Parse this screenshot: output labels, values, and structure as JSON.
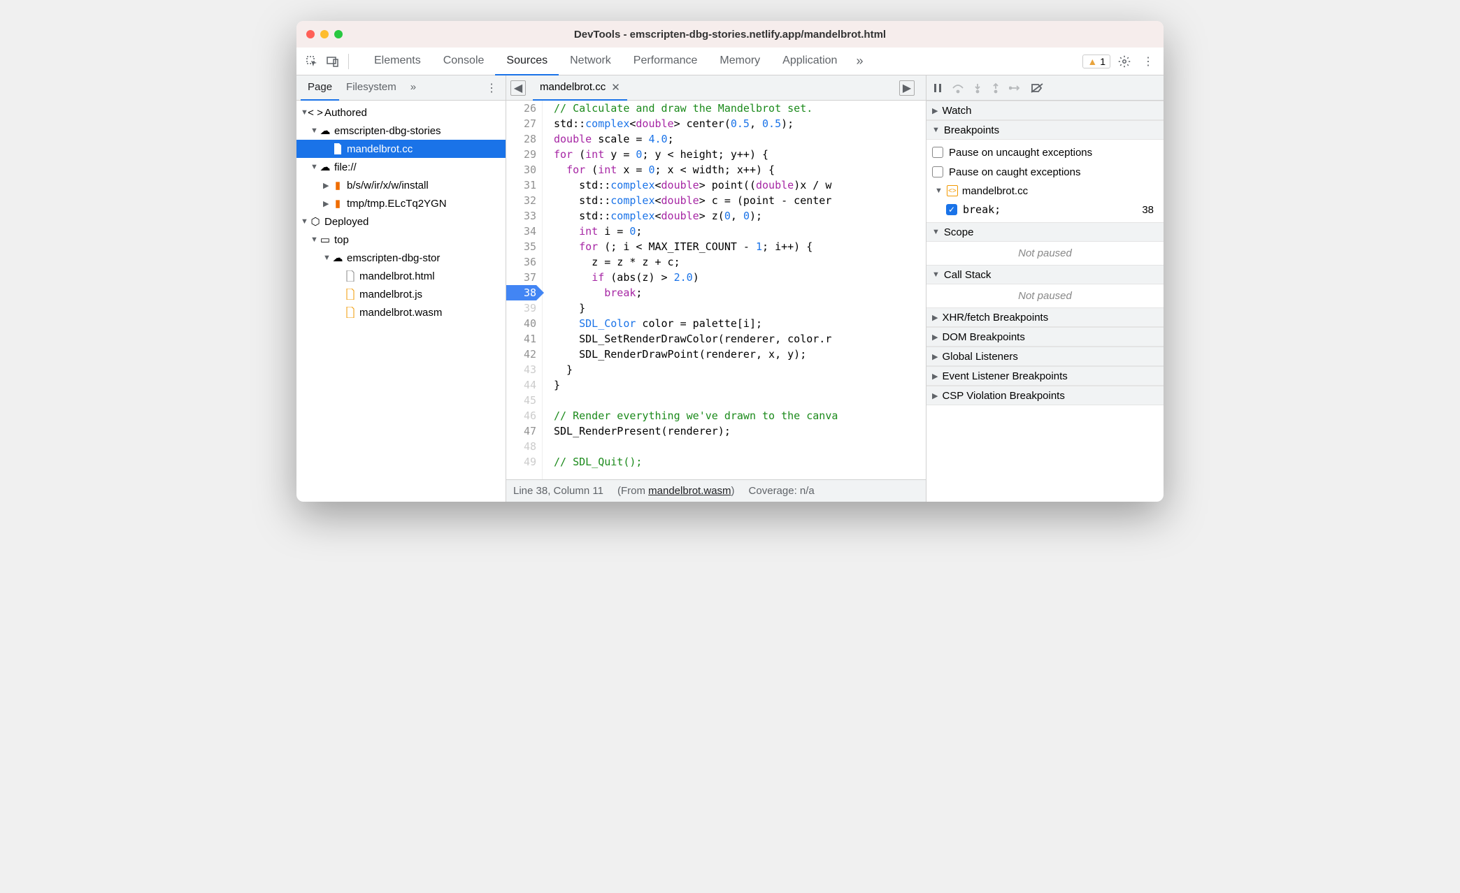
{
  "window": {
    "title": "DevTools - emscripten-dbg-stories.netlify.app/mandelbrot.html"
  },
  "toolbar": {
    "tabs": [
      "Elements",
      "Console",
      "Sources",
      "Network",
      "Performance",
      "Memory",
      "Application"
    ],
    "active_tab": "Sources",
    "warnings": "1"
  },
  "sidebar": {
    "tabs": [
      "Page",
      "Filesystem"
    ],
    "active": "Page",
    "tree": {
      "authored": "Authored",
      "site1": "emscripten-dbg-stories",
      "selected_file": "mandelbrot.cc",
      "file_proto": "file://",
      "install_path": "b/s/w/ir/x/w/install",
      "tmp_path": "tmp/tmp.ELcTq2YGN",
      "deployed": "Deployed",
      "top": "top",
      "site2": "emscripten-dbg-stor",
      "f_html": "mandelbrot.html",
      "f_js": "mandelbrot.js",
      "f_wasm": "mandelbrot.wasm"
    }
  },
  "editor": {
    "tab": "mandelbrot.cc",
    "lines": [
      {
        "n": "26",
        "html": "<span class='tok-comment'>// Calculate and draw the Mandelbrot set.</span>"
      },
      {
        "n": "27",
        "html": "std::<span class='tok-type'>complex</span>&lt;<span class='tok-keyword'>double</span>&gt; center(<span class='tok-number'>0.5</span>, <span class='tok-number'>0.5</span>);"
      },
      {
        "n": "28",
        "html": "<span class='tok-keyword'>double</span> scale = <span class='tok-number'>4.0</span>;"
      },
      {
        "n": "29",
        "html": "<span class='tok-keyword'>for</span> (<span class='tok-keyword'>int</span> y = <span class='tok-number'>0</span>; y &lt; height; y++) {"
      },
      {
        "n": "30",
        "html": "  <span class='tok-keyword'>for</span> (<span class='tok-keyword'>int</span> x = <span class='tok-number'>0</span>; x &lt; width; x++) {"
      },
      {
        "n": "31",
        "html": "    std::<span class='tok-type'>complex</span>&lt;<span class='tok-keyword'>double</span>&gt; point((<span class='tok-keyword'>double</span>)x / w"
      },
      {
        "n": "32",
        "html": "    std::<span class='tok-type'>complex</span>&lt;<span class='tok-keyword'>double</span>&gt; c = (point - center"
      },
      {
        "n": "33",
        "html": "    std::<span class='tok-type'>complex</span>&lt;<span class='tok-keyword'>double</span>&gt; z(<span class='tok-number'>0</span>, <span class='tok-number'>0</span>);"
      },
      {
        "n": "34",
        "html": "    <span class='tok-keyword'>int</span> i = <span class='tok-number'>0</span>;"
      },
      {
        "n": "35",
        "html": "    <span class='tok-keyword'>for</span> (; i &lt; MAX_ITER_COUNT - <span class='tok-number'>1</span>; i++) {"
      },
      {
        "n": "36",
        "html": "      z = z * z + c;"
      },
      {
        "n": "37",
        "html": "      <span class='tok-keyword'>if</span> (abs(z) &gt; <span class='tok-number'>2.0</span>)"
      },
      {
        "n": "38",
        "html": "        <span class='tok-keyword'>break</span>;",
        "bp": true
      },
      {
        "n": "39",
        "html": "    }",
        "gray": true
      },
      {
        "n": "40",
        "html": "    <span class='tok-type'>SDL_Color</span> color = palette[i];"
      },
      {
        "n": "41",
        "html": "    SDL_SetRenderDrawColor(renderer, color.r"
      },
      {
        "n": "42",
        "html": "    SDL_RenderDrawPoint(renderer, x, y);"
      },
      {
        "n": "43",
        "html": "  }",
        "gray": true
      },
      {
        "n": "44",
        "html": "}",
        "gray": true
      },
      {
        "n": "45",
        "html": "",
        "gray": true
      },
      {
        "n": "46",
        "html": "<span class='tok-comment'>// Render everything we've drawn to the canva</span>",
        "gray": true
      },
      {
        "n": "47",
        "html": "SDL_RenderPresent(renderer);"
      },
      {
        "n": "48",
        "html": "",
        "gray": true
      },
      {
        "n": "49",
        "html": "<span class='tok-comment'>// SDL_Quit();</span>",
        "gray": true
      }
    ]
  },
  "status": {
    "pos": "Line 38, Column 11",
    "from_prefix": "(From ",
    "from_link": "mandelbrot.wasm",
    "from_suffix": ")",
    "coverage": "Coverage: n/a"
  },
  "debug": {
    "sections": {
      "watch": "Watch",
      "breakpoints": "Breakpoints",
      "scope": "Scope",
      "callstack": "Call Stack",
      "xhr": "XHR/fetch Breakpoints",
      "dom": "DOM Breakpoints",
      "global": "Global Listeners",
      "event": "Event Listener Breakpoints",
      "csp": "CSP Violation Breakpoints"
    },
    "pause_uncaught": "Pause on uncaught exceptions",
    "pause_caught": "Pause on caught exceptions",
    "bp_file": "mandelbrot.cc",
    "bp_code": "break;",
    "bp_line": "38",
    "not_paused": "Not paused"
  }
}
